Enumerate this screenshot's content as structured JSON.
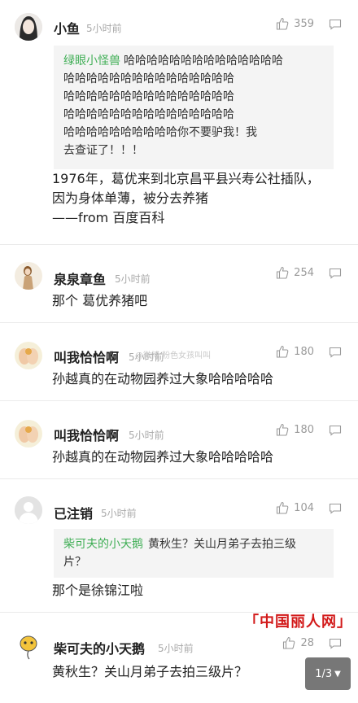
{
  "comments": [
    {
      "name": "小鱼",
      "time": "5小时前",
      "likes": "359",
      "avatar": "portrait-avatar",
      "quote": {
        "name": "绿眼小怪兽",
        "lines": [
          "哈哈哈哈哈哈哈哈哈哈哈哈哈哈",
          "哈哈哈哈哈哈哈哈哈哈哈哈哈哈哈",
          "哈哈哈哈哈哈哈哈哈哈哈哈哈哈哈",
          "哈哈哈哈哈哈哈哈哈哈哈哈哈哈哈",
          "哈哈哈哈哈哈哈哈哈哈你不要驴我！我",
          "去查证了！！！"
        ]
      },
      "body": [
        "1976年，葛优来到北京昌平县兴寿公社插队，",
        "因为身体单薄，被分去养猪",
        "——from 百度百科"
      ]
    },
    {
      "name": "泉泉章鱼",
      "time": "5小时前",
      "likes": "254",
      "avatar": "girl-avatar",
      "body": [
        "那个 葛优养猪吧"
      ]
    },
    {
      "name": "叫我恰恰啊",
      "time": "5小时前",
      "likes": "180",
      "avatar": "hands-avatar",
      "body": [
        "孙越真的在动物园养过大象哈哈哈哈哈"
      ]
    },
    {
      "name": "叫我恰恰啊",
      "time": "5小时前",
      "likes": "180",
      "avatar": "hands-avatar",
      "body": [
        "孙越真的在动物园养过大象哈哈哈哈哈"
      ]
    },
    {
      "name": "已注销",
      "time": "5小时前",
      "likes": "104",
      "avatar": "default-user-avatar",
      "quote": {
        "name": "柴可夫的小天鹅",
        "lines": [
          "黄秋生？关山月弟子去拍三级",
          "片？"
        ]
      },
      "body": [
        "那个是徐锦江啦"
      ]
    },
    {
      "name": "柴可夫的小天鹅",
      "time": "5小时前",
      "likes": "28",
      "avatar": "duck-avatar",
      "body": [
        "黄秋生？关山月弟子去拍三级片？"
      ]
    }
  ],
  "watermark": "@微博  粉色女孩叫叫",
  "site_logo": "「中国丽人网」",
  "pager": {
    "label": "1/3",
    "icon": "caret-down-icon"
  },
  "colors": {
    "quote_name": "#3fae55",
    "logo": "#d21a1a",
    "meta": "#a9a9a9"
  }
}
